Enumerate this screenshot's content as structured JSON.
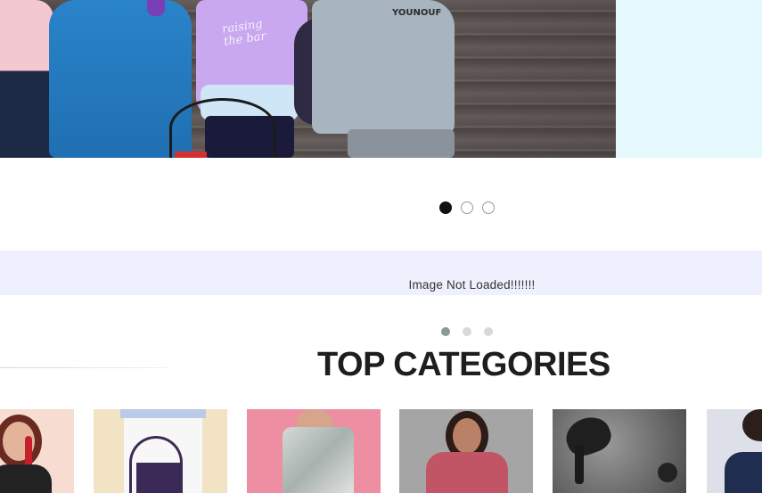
{
  "hero": {
    "shirt_text_1": "raising the bar",
    "shirt_text_2": "YOUNOUF"
  },
  "carousel": {
    "slides": 3,
    "active_slide": 1
  },
  "promo_banner": {
    "fallback_text": "Image Not Loaded!!!!!!!"
  },
  "promo_carousel": {
    "slides": 3,
    "active_slide": 1
  },
  "section": {
    "title": "TOP CATEGORIES"
  },
  "categories": [
    {
      "bg": "#f5dcd2"
    },
    {
      "bg": "#f1e2c4"
    },
    {
      "bg": "#ee8fa4"
    },
    {
      "bg": "#9a9a9a"
    },
    {
      "bg": "#bcbcbc"
    },
    {
      "bg": "#d9dde6"
    }
  ]
}
